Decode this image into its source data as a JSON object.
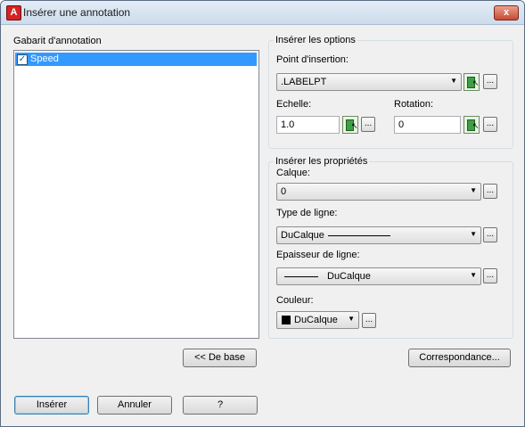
{
  "window": {
    "title": "Insérer une annotation",
    "close": "x"
  },
  "template": {
    "label": "Gabarit d'annotation",
    "items": [
      {
        "label": "Speed",
        "checked": true
      }
    ]
  },
  "options": {
    "group_title": "Insérer les options",
    "insertion_point_label": "Point d'insertion:",
    "insertion_point_value": ".LABELPT",
    "scale_label": "Echelle:",
    "scale_value": "1.0",
    "rotation_label": "Rotation:",
    "rotation_value": "0"
  },
  "properties": {
    "group_title": "Insérer les propriétés",
    "layer_label": "Calque:",
    "layer_value": "0",
    "linetype_label": "Type de ligne:",
    "linetype_value": "DuCalque",
    "lineweight_label": "Epaisseur de ligne:",
    "lineweight_value": "DuCalque",
    "color_label": "Couleur:",
    "color_value": "DuCalque",
    "color_swatch": "#000000"
  },
  "buttons": {
    "ellipsis": "...",
    "basic": "<< De base",
    "match": "Correspondance...",
    "insert": "Insérer",
    "cancel": "Annuler",
    "help": "?"
  },
  "icons": {
    "app": "autocad-icon",
    "pick": "pick-point-icon",
    "dropdown": "chevron-down-icon",
    "check": "checkmark-icon"
  }
}
